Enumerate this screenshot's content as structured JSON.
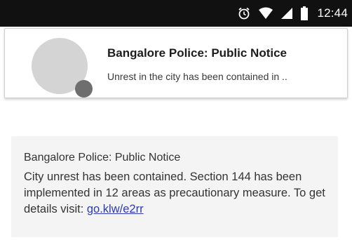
{
  "status_bar": {
    "time": "12:44",
    "icons": [
      "alarm-icon",
      "wifi-icon",
      "signal-icon",
      "battery-icon"
    ]
  },
  "notification": {
    "title": "Bangalore Police: Public Notice",
    "preview": "Unrest in the city has been contained in .."
  },
  "message": {
    "sender": "Bangalore Police: Public Notice",
    "body_text": "City unrest has been contained. Section 144 has been implemented in 12 areas as precautionary measure. To get details visit: ",
    "link_text": "go.klw/e2rr"
  },
  "colors": {
    "status_bar_bg": "#111111",
    "link": "#2a3ab5",
    "message_bg": "#f4f4f4",
    "avatar": "#d4d4d4",
    "avatar_badge": "#6e6e6e"
  }
}
